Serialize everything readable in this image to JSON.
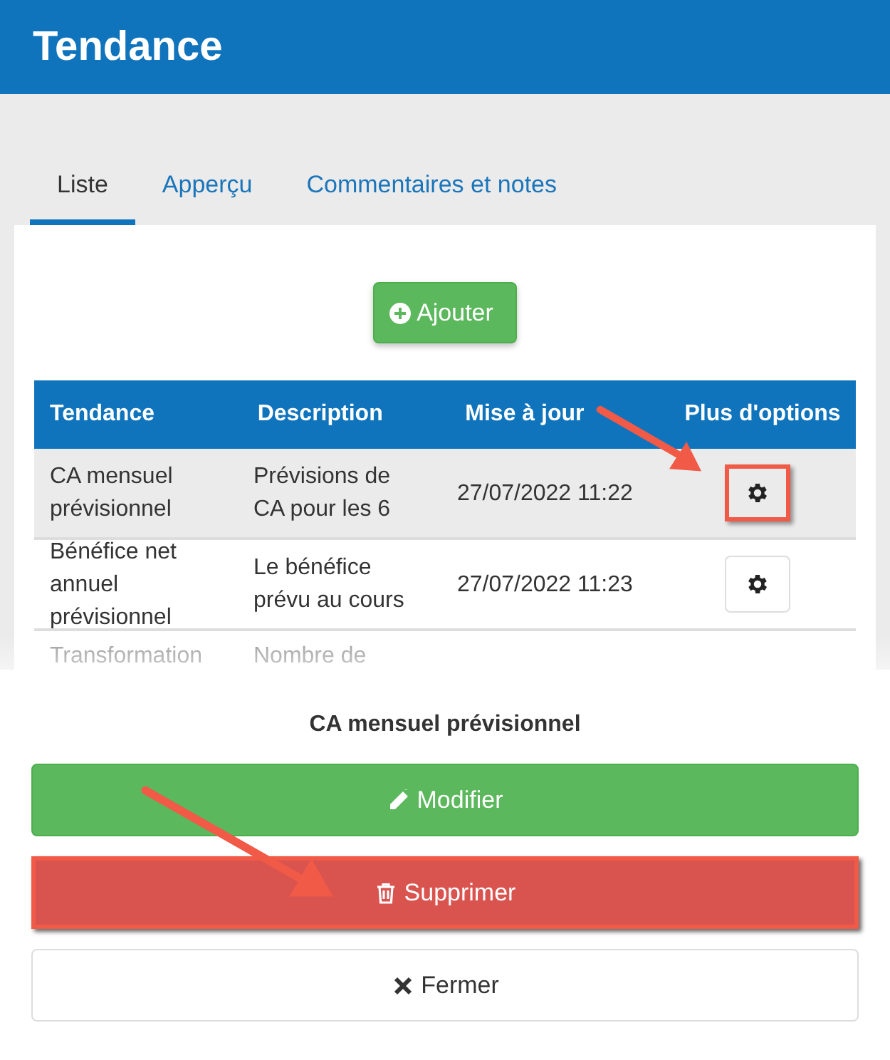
{
  "header": {
    "title": "Tendance"
  },
  "tabs": [
    {
      "label": "Liste",
      "selected": true
    },
    {
      "label": "Apperçu",
      "selected": false
    },
    {
      "label": "Commentaires et notes",
      "selected": false
    }
  ],
  "add_button": {
    "label": "Ajouter"
  },
  "table": {
    "columns": [
      "Tendance",
      "Description",
      "Mise à jour",
      "Plus d'options"
    ],
    "rows": [
      {
        "tendance": "CA mensuel prévisionnel",
        "description": "Prévisions de CA pour les 6",
        "updated": "27/07/2022 11:22",
        "selected": true,
        "highlighted": true,
        "options_button": true
      },
      {
        "tendance": "Bénéfice net annuel prévisionnel",
        "description": "Le bénéfice prévu au cours",
        "updated": "27/07/2022 11:23",
        "selected": false,
        "highlighted": false,
        "options_button": true
      },
      {
        "tendance": "Transformation",
        "description": "Nombre de",
        "selected": false,
        "options_button": false
      }
    ]
  },
  "action_sheet": {
    "title": "CA mensuel prévisionnel",
    "actions": [
      {
        "kind": "edit",
        "label": "Modifier",
        "highlighted": false
      },
      {
        "kind": "delete",
        "label": "Supprimer",
        "highlighted": true
      },
      {
        "kind": "close",
        "label": "Fermer",
        "highlighted": false
      }
    ]
  }
}
